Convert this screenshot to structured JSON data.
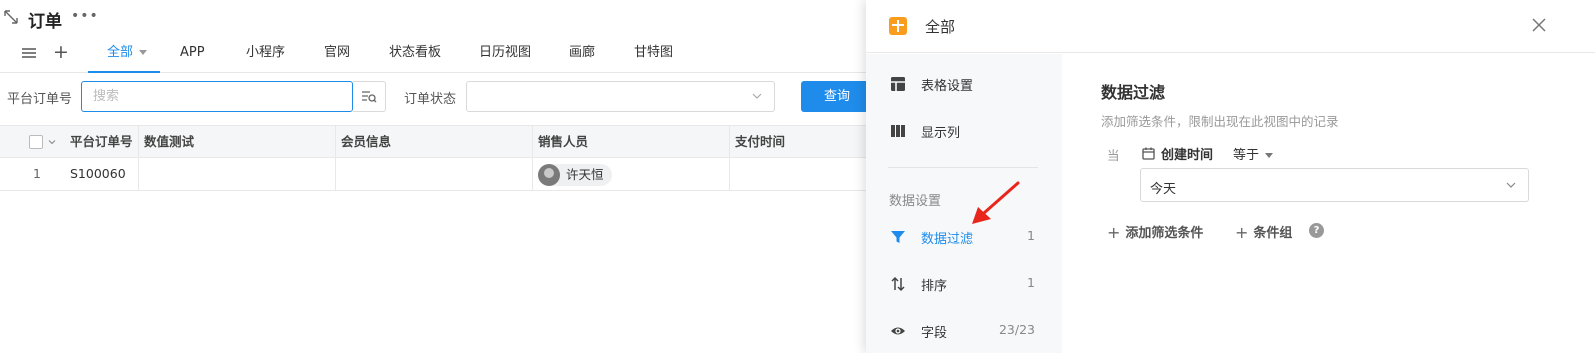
{
  "page": {
    "title": "订单",
    "more_icon": "more-icon"
  },
  "view_tabs": [
    {
      "label": "全部",
      "active": true
    },
    {
      "label": "APP"
    },
    {
      "label": "小程序"
    },
    {
      "label": "官网"
    },
    {
      "label": "状态看板"
    },
    {
      "label": "日历视图"
    },
    {
      "label": "画廊"
    },
    {
      "label": "甘特图"
    }
  ],
  "filters": {
    "order_no_label": "平台订单号",
    "search_placeholder": "搜索",
    "status_label": "订单状态",
    "status_value": "",
    "query_button": "查询"
  },
  "table": {
    "columns": [
      "平台订单号",
      "数值测试",
      "会员信息",
      "销售人员",
      "支付时间"
    ],
    "rows": [
      {
        "index": "1",
        "order_no": "S100060",
        "value_test": "",
        "member": "",
        "salesperson": "许天恒",
        "pay_time": ""
      }
    ]
  },
  "drawer": {
    "title": "全部",
    "nav": {
      "table_settings": "表格设置",
      "show_columns": "显示列",
      "data_section": "数据设置",
      "data_filter": "数据过滤",
      "data_filter_count": "1",
      "sort": "排序",
      "sort_count": "1",
      "fields": "字段",
      "fields_count": "23/23"
    },
    "content": {
      "title": "数据过滤",
      "description": "添加筛选条件，限制出现在此视图中的记录",
      "when": "当",
      "field": "创建时间",
      "operator": "等于",
      "value": "今天",
      "add_condition": "添加筛选条件",
      "condition_group": "条件组",
      "help": "?"
    }
  },
  "colors": {
    "accent": "#1f8ceb",
    "drawer_icon": "#fa9c1d",
    "annotation_arrow": "#e8261c"
  }
}
